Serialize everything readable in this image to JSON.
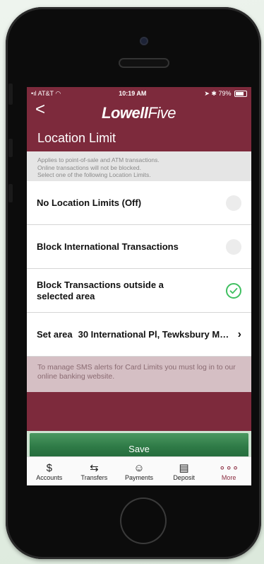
{
  "status_bar": {
    "carrier": "AT&T",
    "time": "10:19 AM",
    "battery": "79%"
  },
  "header": {
    "back_glyph": "<",
    "logo_bold": "Lowell",
    "logo_light": "Five",
    "title": "Location Limit"
  },
  "info_text": {
    "line1": "Applies to point-of-sale and ATM transactions.",
    "line2": "Online transactions will not be blocked.",
    "line3": "Select one of the following Location Limits."
  },
  "options": [
    {
      "label": "No Location Limits (Off)",
      "selected": false
    },
    {
      "label": "Block International Transactions",
      "selected": false
    },
    {
      "label_line1": "Block Transactions outside a",
      "label_line2": "selected area",
      "selected": true
    }
  ],
  "set_area": {
    "label": "Set area",
    "value": "30 International Pl, Tewksbury MA 0..."
  },
  "sms_note": "To manage SMS alerts for Card Limits you must log in to our online banking website.",
  "save_label": "Save",
  "tabs": [
    {
      "icon": "$",
      "label": "Accounts",
      "active": false
    },
    {
      "icon": "⇆",
      "label": "Transfers",
      "active": false
    },
    {
      "icon": "☺",
      "label": "Payments",
      "active": false
    },
    {
      "icon": "▤",
      "label": "Deposit",
      "active": false
    },
    {
      "icon": "∘∘∘",
      "label": "More",
      "active": true
    }
  ],
  "colors": {
    "brand_maroon": "#7d2a3c",
    "save_green": "#2e7a46",
    "check_green": "#3fbf60"
  }
}
